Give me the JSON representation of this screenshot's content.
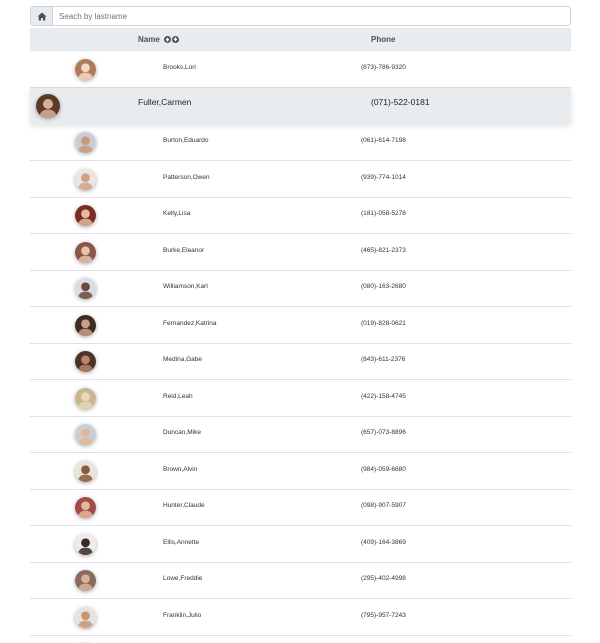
{
  "search": {
    "placeholder": "Seach by lastname",
    "home_icon": "home-icon"
  },
  "table": {
    "columns": {
      "name": "Name",
      "phone": "Phone",
      "sort_icons": [
        "sort-up-icon",
        "sort-down-icon"
      ]
    },
    "selected_index": 1,
    "rows": [
      {
        "name": "Brooks,Lori",
        "phone": "(873)-786-9320",
        "avatar_bg": "#b07a5a",
        "avatar_fg": "#f1d9c3"
      },
      {
        "name": "Fuller,Carmen",
        "phone": "(071)-522-0181",
        "avatar_bg": "#5a3a28",
        "avatar_fg": "#d9b096"
      },
      {
        "name": "Burton,Eduardo",
        "phone": "(061)-614-7198",
        "avatar_bg": "#c8ccd4",
        "avatar_fg": "#c89a7a"
      },
      {
        "name": "Patterson,Owen",
        "phone": "(939)-774-1014",
        "avatar_bg": "#e6e6e6",
        "avatar_fg": "#d4a17f"
      },
      {
        "name": "Kelly,Lisa",
        "phone": "(181)-058-5278",
        "avatar_bg": "#7a2e22",
        "avatar_fg": "#e6b9a0"
      },
      {
        "name": "Burke,Eleanor",
        "phone": "(465)-821-2373",
        "avatar_bg": "#8a5548",
        "avatar_fg": "#e8c2ab"
      },
      {
        "name": "Williamson,Karl",
        "phone": "(080)-163-2680",
        "avatar_bg": "#d8dde6",
        "avatar_fg": "#6a4a3a"
      },
      {
        "name": "Fernandez,Katrina",
        "phone": "(019)-828-0621",
        "avatar_bg": "#3e2b22",
        "avatar_fg": "#c9a08a"
      },
      {
        "name": "Medina,Gabe",
        "phone": "(843)-611-2376",
        "avatar_bg": "#4a3226",
        "avatar_fg": "#b98568"
      },
      {
        "name": "Reid,Leah",
        "phone": "(422)-158-4745",
        "avatar_bg": "#c8b890",
        "avatar_fg": "#ead6bb"
      },
      {
        "name": "Duncan,Mike",
        "phone": "(657)-073-8896",
        "avatar_bg": "#c9ced6",
        "avatar_fg": "#e0b89c"
      },
      {
        "name": "Brown,Alvin",
        "phone": "(984)-059-6680",
        "avatar_bg": "#e8e4d8",
        "avatar_fg": "#8a5a3c"
      },
      {
        "name": "Hunter,Claude",
        "phone": "(098)-907-5907",
        "avatar_bg": "#a04a4a",
        "avatar_fg": "#e6b69a"
      },
      {
        "name": "Ellis,Annette",
        "phone": "(409)-164-3869",
        "avatar_bg": "#ececec",
        "avatar_fg": "#3a2a22"
      },
      {
        "name": "Lowe,Freddie",
        "phone": "(295)-402-4998",
        "avatar_bg": "#8a6a5a",
        "avatar_fg": "#d8b29a"
      },
      {
        "name": "Franklin,Julio",
        "phone": "(795)-957-7243",
        "avatar_bg": "#e4e4e4",
        "avatar_fg": "#c9966f"
      },
      {
        "name": "",
        "phone": "",
        "avatar_bg": "#9a8a80",
        "avatar_fg": "#d9b9a4"
      }
    ]
  }
}
